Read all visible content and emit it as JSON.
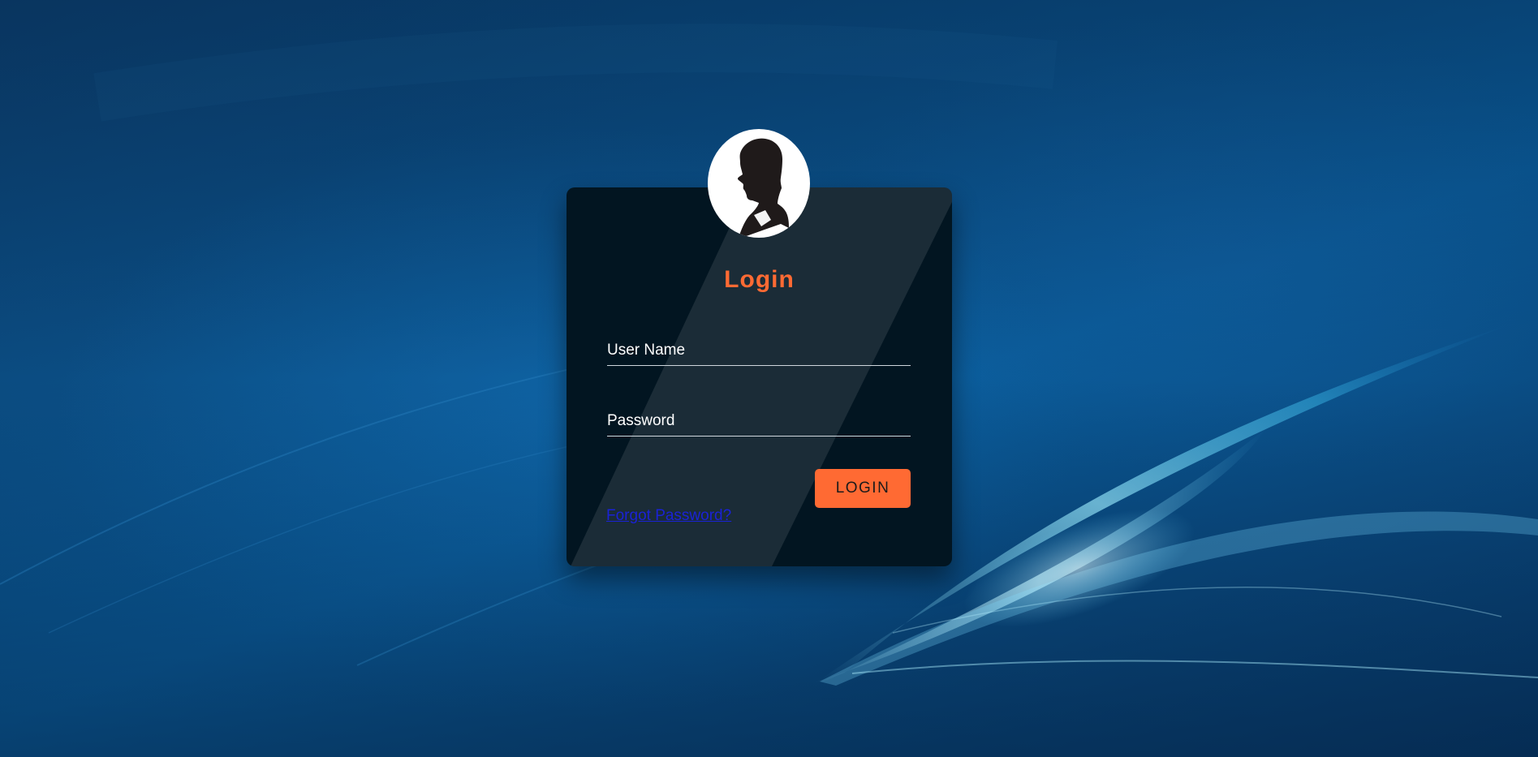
{
  "login_form": {
    "title": "Login",
    "username_placeholder": "User Name",
    "password_placeholder": "Password",
    "login_button_label": "LOGIN",
    "forgot_password_link": "Forgot Password?"
  },
  "avatar": {
    "icon": "user-silhouette-icon"
  },
  "colors": {
    "accent": "#ff6a33",
    "card_background": "#021521",
    "link": "#1a22d6",
    "background": "#0b4f86"
  }
}
